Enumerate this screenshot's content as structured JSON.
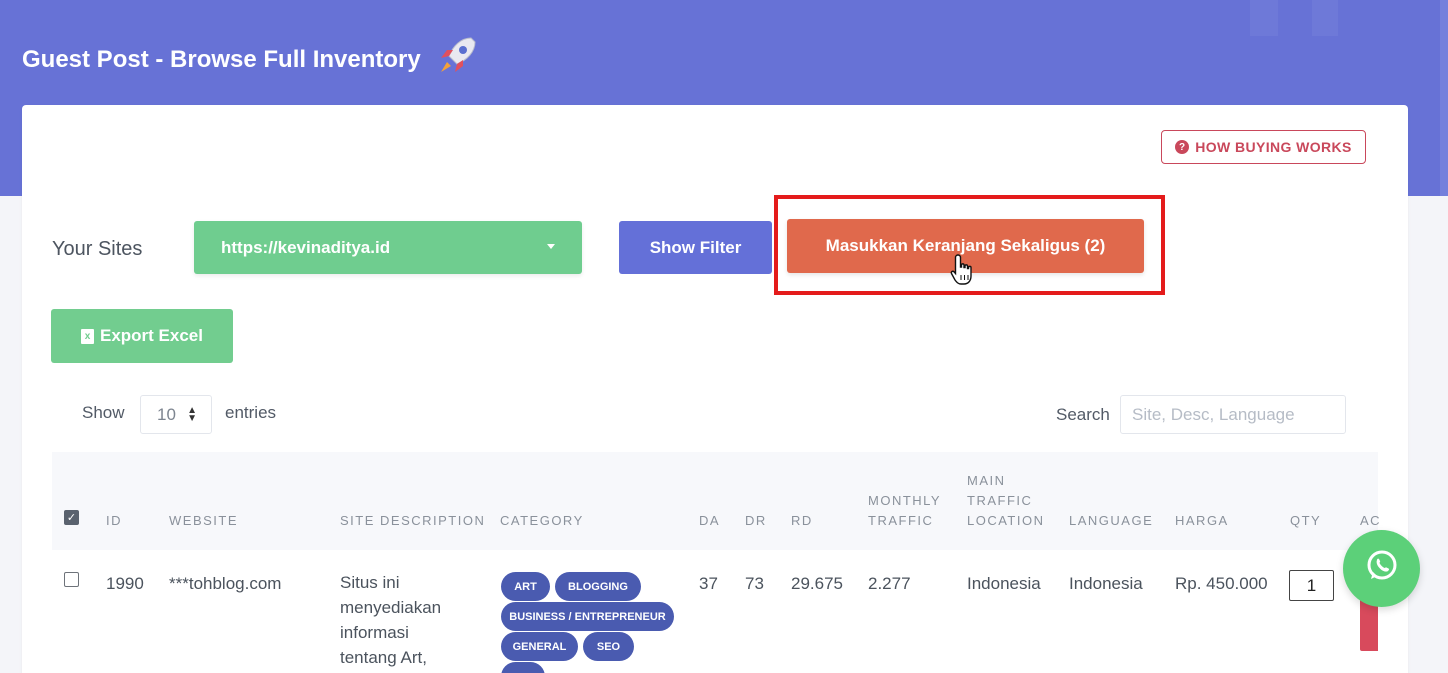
{
  "header": {
    "title": "Guest Post - Browse Full Inventory",
    "icon": "rocket-icon"
  },
  "how_buying_works": {
    "label": "HOW BUYING WORKS",
    "icon": "question-circle-icon"
  },
  "sites": {
    "label": "Your Sites",
    "selected": "https://kevinaditya.id"
  },
  "toolbar": {
    "show_filter_label": "Show Filter",
    "add_all_to_cart_label": "Masukkan Keranjang Sekaligus (2)",
    "export_label": "Export Excel"
  },
  "length_menu": {
    "show_label": "Show",
    "value": "10",
    "entries_label": "entries"
  },
  "search": {
    "label": "Search",
    "placeholder": "Site, Desc, Language"
  },
  "table": {
    "columns": {
      "id": "ID",
      "website": "WEBSITE",
      "site_description": "SITE DESCRIPTION",
      "category": "CATEGORY",
      "da": "DA",
      "dr": "DR",
      "rd": "RD",
      "monthly_traffic_1": "MONTHLY",
      "monthly_traffic_2": "TRAFFIC",
      "main_location_1": "MAIN",
      "main_location_2": "TRAFFIC",
      "main_location_3": "LOCATION",
      "language": "LANGUAGE",
      "harga": "HARGA",
      "qty": "QTY",
      "action": "AC"
    },
    "rows": [
      {
        "id": "1990",
        "website": "***tohblog.com",
        "description_lines": [
          "Situs ini",
          "menyediakan",
          "informasi",
          "tentang Art,"
        ],
        "categories": [
          "ART",
          "BLOGGING",
          "BUSINESS / ENTREPRENEUR",
          "GENERAL",
          "SEO"
        ],
        "da": "37",
        "dr": "73",
        "rd": "29.675",
        "monthly_traffic": "2.277",
        "main_location": "Indonesia",
        "language": "Indonesia",
        "harga": "Rp. 450.000",
        "qty": "1"
      }
    ]
  },
  "colors": {
    "header_bg": "#6772d6",
    "site_select": "#6fcd8f",
    "show_filter": "#6470d8",
    "cart_button": "#e0694c",
    "highlight": "#e41b1b",
    "tag": "#4a5bb0",
    "whatsapp": "#5cd079"
  }
}
